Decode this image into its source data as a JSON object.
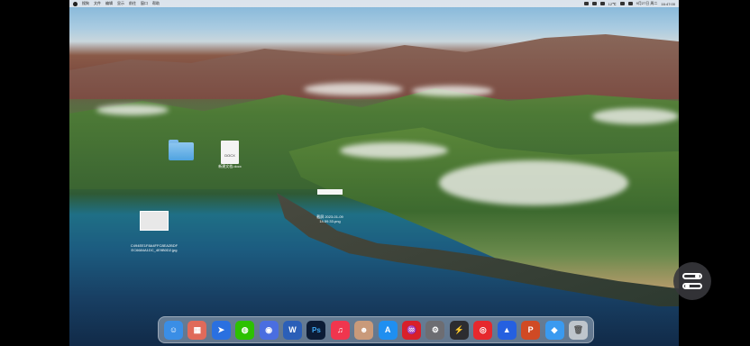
{
  "menubar": {
    "items": [
      "搜狗",
      "文件",
      "编辑",
      "显示",
      "前往",
      "窗口",
      "帮助"
    ],
    "battery": "12℃",
    "date": "9月27日 周二",
    "time": "16:47:00"
  },
  "desktop": {
    "folder_label": "",
    "doc_name": "DOCX",
    "doc_label": "新建文档.docx",
    "screenshot_label": "截屏 2023-01-09\n14.59.33.png",
    "image_label": "C494EE1F8A4FFC8EA2BDF\nEC6684A1DC_4E9B0D2.jpg"
  },
  "dock": {
    "apps": [
      {
        "name": "finder-icon",
        "glyph": "☺",
        "color": "#3a8ee6"
      },
      {
        "name": "launchpad-icon",
        "glyph": "▦",
        "color": "#e06a5a"
      },
      {
        "name": "feishu-icon",
        "glyph": "➤",
        "color": "#2a70e0"
      },
      {
        "name": "wechat-icon",
        "glyph": "◍",
        "color": "#2dc100"
      },
      {
        "name": "browser-icon",
        "glyph": "◉",
        "color": "#4a6ee0"
      },
      {
        "name": "word-icon",
        "glyph": "W",
        "color": "#2b5fb8"
      },
      {
        "name": "photoshop-icon",
        "glyph": "Ps",
        "color": "#0c1c36"
      },
      {
        "name": "music-icon",
        "glyph": "♫",
        "color": "#f0364e"
      },
      {
        "name": "avatar-icon",
        "glyph": "☻",
        "color": "#c99a7a"
      },
      {
        "name": "appstore-icon",
        "glyph": "A",
        "color": "#1f8ff0"
      },
      {
        "name": "netease-music-icon",
        "glyph": "♒",
        "color": "#d8202a"
      },
      {
        "name": "settings-icon",
        "glyph": "⚙",
        "color": "#6d6d72"
      },
      {
        "name": "bolt-icon",
        "glyph": "⚡",
        "color": "#2c2c30"
      },
      {
        "name": "netease-cloud-icon",
        "glyph": "◎",
        "color": "#e6282d"
      },
      {
        "name": "bookmark-icon",
        "glyph": "▲",
        "color": "#2560e0"
      },
      {
        "name": "powerpoint-icon",
        "glyph": "P",
        "color": "#d04a24"
      },
      {
        "name": "app-blue-icon",
        "glyph": "◆",
        "color": "#3a9af0"
      },
      {
        "name": "trash-icon",
        "glyph": "🗑",
        "color": "#bfc5cc"
      }
    ]
  },
  "floating_control": {
    "icon": "toggle-switches-icon"
  }
}
